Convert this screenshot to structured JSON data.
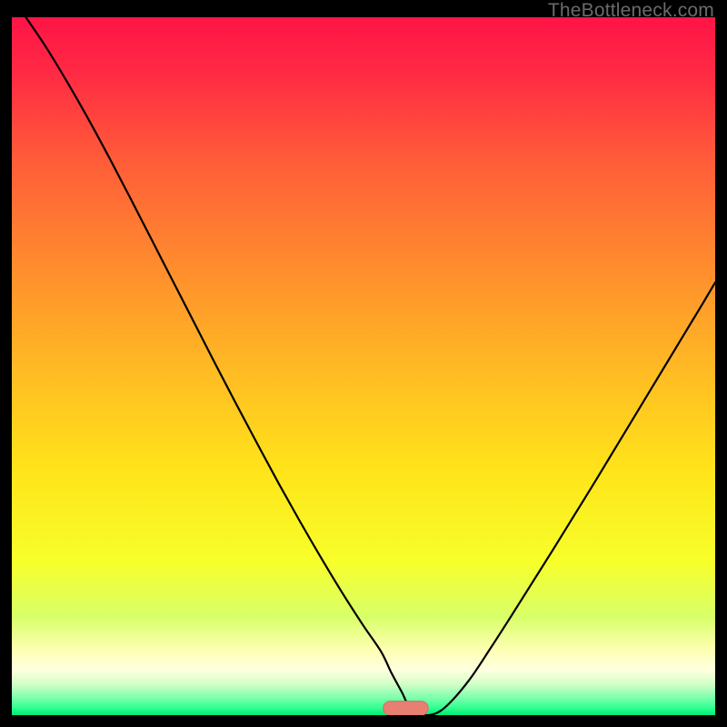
{
  "watermark": "TheBottleneck.com",
  "colors": {
    "black": "#000000",
    "curve": "#000000",
    "marker_fill": "#e77f73",
    "marker_stroke": "#d96b5f",
    "gradient_stops": [
      {
        "offset": 0.0,
        "color": "#ff1446"
      },
      {
        "offset": 0.08,
        "color": "#ff2a44"
      },
      {
        "offset": 0.2,
        "color": "#ff5a39"
      },
      {
        "offset": 0.35,
        "color": "#ff8a2e"
      },
      {
        "offset": 0.5,
        "color": "#ffb924"
      },
      {
        "offset": 0.65,
        "color": "#ffe41a"
      },
      {
        "offset": 0.78,
        "color": "#f7ff2a"
      },
      {
        "offset": 0.86,
        "color": "#d8ff6a"
      },
      {
        "offset": 0.905,
        "color": "#fdffb0"
      },
      {
        "offset": 0.935,
        "color": "#ffffe0"
      },
      {
        "offset": 0.955,
        "color": "#d4ffc6"
      },
      {
        "offset": 0.975,
        "color": "#7cffad"
      },
      {
        "offset": 0.99,
        "color": "#2eff8f"
      },
      {
        "offset": 1.0,
        "color": "#00e876"
      }
    ]
  },
  "chart_data": {
    "type": "line",
    "title": "",
    "xlabel": "",
    "ylabel": "",
    "xlim": [
      0,
      100
    ],
    "ylim": [
      0,
      100
    ],
    "marker": {
      "x": 56,
      "y": 0,
      "rx": 3.2,
      "ry": 1.0
    },
    "series": [
      {
        "name": "bottleneck-curve",
        "x": [
          2,
          5,
          8,
          11,
          14,
          17,
          20,
          23,
          26,
          29,
          32,
          35,
          38,
          41,
          44,
          47,
          50,
          52.5,
          54,
          55.5,
          56.5,
          58,
          60,
          62,
          65,
          68,
          71,
          74,
          77,
          80,
          83,
          86,
          89,
          92,
          95,
          98,
          100
        ],
        "y": [
          100,
          95.5,
          90.5,
          85.2,
          79.6,
          73.8,
          67.9,
          62.0,
          56.1,
          50.2,
          44.4,
          38.7,
          33.1,
          27.7,
          22.5,
          17.5,
          12.8,
          9.1,
          6.0,
          3.2,
          1.2,
          0.15,
          0.15,
          1.5,
          5.0,
          9.5,
          14.2,
          19.0,
          23.8,
          28.7,
          33.6,
          38.6,
          43.6,
          48.6,
          53.6,
          58.6,
          62.0
        ]
      }
    ]
  }
}
